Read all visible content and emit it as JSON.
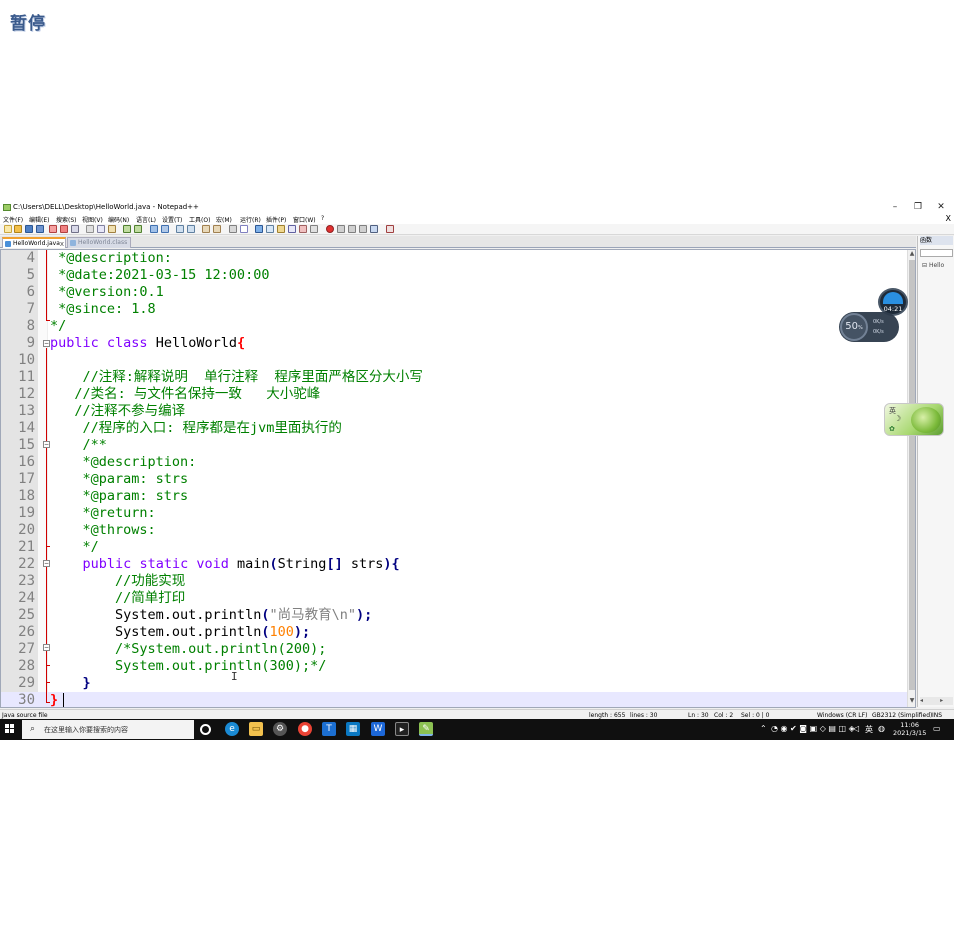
{
  "overlay": {
    "pause_label": "暂停"
  },
  "window": {
    "title": "C:\\Users\\DELL\\Desktop\\HelloWorld.java - Notepad++",
    "minimize": "–",
    "maximize": "❐",
    "close": "✕"
  },
  "menu": {
    "items": [
      "文件(F)",
      "编辑(E)",
      "搜索(S)",
      "视图(V)",
      "编码(N)",
      "语言(L)",
      "设置(T)",
      "工具(O)",
      "宏(M)",
      "运行(R)",
      "插件(P)",
      "窗口(W)",
      "?"
    ],
    "close": "X"
  },
  "tabs": [
    {
      "label": "HelloWorld.java",
      "close": "x"
    },
    {
      "label": "HelloWorld.class"
    }
  ],
  "editor": {
    "line_numbers": [
      "4",
      "5",
      "6",
      "7",
      "8",
      "9",
      "10",
      "11",
      "12",
      "13",
      "14",
      "15",
      "16",
      "17",
      "18",
      "19",
      "20",
      "21",
      "22",
      "23",
      "24",
      "25",
      "26",
      "27",
      "28",
      "29",
      "30"
    ],
    "l4_a": " *@description:",
    "l5_a": " *@date:2021-03-15 12:00:00",
    "l6_a": " *@version:0.1",
    "l7_a": " *@since: 1.8",
    "l8_a": "*/",
    "l9_kw1": "public",
    "l9_kw2": "class",
    "l9_name": " HelloWorld",
    "l9_brace": "{",
    "l10_a": "",
    "l11_a": "    //注释:解释说明  单行注释  程序里面严格区分大小写",
    "l12_a": "   //类名: 与文件名保持一致   大小驼峰",
    "l13_a": "   //注释不参与编译",
    "l14_a": "    //程序的入口: 程序都是在jvm里面执行的",
    "l15_a": "    /**",
    "l16_a": "    *@description:",
    "l17_a": "    *@param: strs",
    "l18_a": "    *@param: strs",
    "l19_a": "    *@return:",
    "l20_a": "    *@throws:",
    "l21_a": "    */",
    "l22_indent": "    ",
    "l22_kw1": "public",
    "l22_kw2": "static",
    "l22_kw3": "void",
    "l22_name": " main",
    "l22_p1": "(",
    "l22_type": "String",
    "l22_br": "[]",
    "l22_arg": " strs",
    "l22_p2": "){",
    "l23_a": "        //功能实现",
    "l24_a": "        //简单打印",
    "l25_pre": "        System.out.println",
    "l25_p1": "(",
    "l25_str": "\"尚马教育\\n\"",
    "l25_p2": ");",
    "l26_pre": "        System.out.println",
    "l26_p1": "(",
    "l26_num": "100",
    "l26_p2": ");",
    "l27_a": "        /*System.out.println(200);",
    "l28_a": "        System.out.println(300);*/",
    "l29_a": "    }",
    "l30_a": "}",
    "cursor_glyph": "I"
  },
  "right_panel": {
    "title": "函数",
    "tree_item": "Hello"
  },
  "statusbar": {
    "file_type": "Java source file",
    "length": "length : 655",
    "lines": "lines : 30",
    "ln": "Ln : 30",
    "col": "Col : 2",
    "sel": "Sel : 0 | 0",
    "eol": "Windows (CR LF)",
    "encoding": "GB2312 (Simplified)",
    "mode": "INS"
  },
  "taskbar": {
    "search_placeholder": "在这里输入你要搜索的内容",
    "ime_lang": "英",
    "time": "11:06",
    "date": "2021/3/15"
  },
  "widgets": {
    "memory_value": "50",
    "memory_unit": "%",
    "speed_up": "0K/s",
    "speed_down": "0K/s",
    "timer": "04:21",
    "green_label": "英"
  },
  "colors": {
    "comment": "#008000",
    "keyword": "#8000ff",
    "number": "#ff8000",
    "string": "#808080",
    "brace_match": "#ff0000",
    "current_line": "#e8e8ff"
  }
}
